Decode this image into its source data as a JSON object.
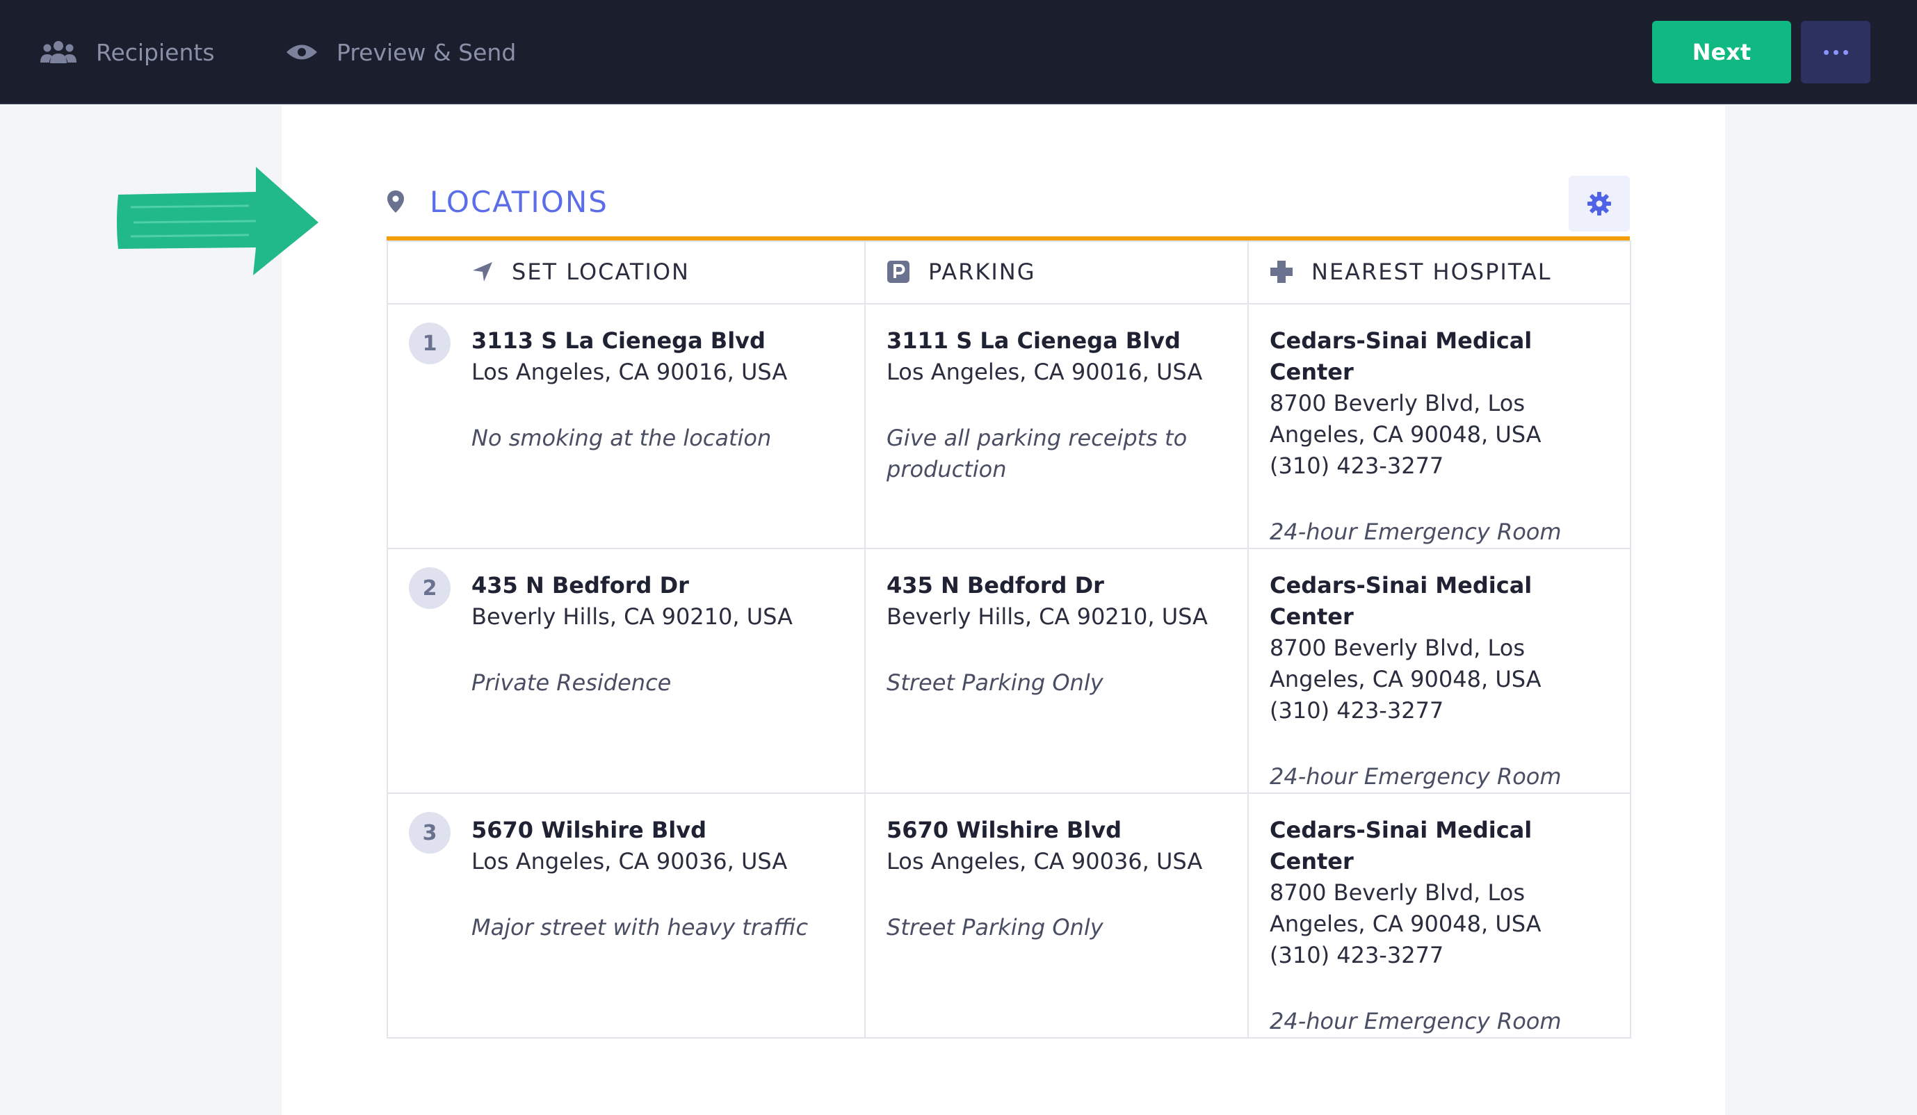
{
  "nav": {
    "recipients": "Recipients",
    "preview_send": "Preview & Send",
    "next": "Next"
  },
  "section": {
    "title": "LOCATIONS"
  },
  "columns": {
    "set_location": "SET LOCATION",
    "parking": "PARKING",
    "nearest_hospital": "NEAREST HOSPITAL"
  },
  "rows": [
    {
      "number": "1",
      "location": {
        "street": "3113 S La Cienega Blvd",
        "city": "Los Angeles, CA 90016, USA",
        "note": "No smoking at the location"
      },
      "parking": {
        "street": "3111 S La Cienega Blvd",
        "city": "Los Angeles, CA 90016, USA",
        "note": "Give all parking receipts to production"
      },
      "hospital": {
        "name": "Cedars-Sinai Medical Center",
        "address": "8700 Beverly Blvd, Los Angeles, CA 90048, USA",
        "phone": "(310) 423-3277",
        "note": "24-hour Emergency Room"
      }
    },
    {
      "number": "2",
      "location": {
        "street": "435 N Bedford Dr",
        "city": "Beverly Hills, CA 90210, USA",
        "note": "Private Residence"
      },
      "parking": {
        "street": "435 N Bedford Dr",
        "city": "Beverly Hills, CA 90210, USA",
        "note": "Street Parking Only"
      },
      "hospital": {
        "name": "Cedars-Sinai Medical Center",
        "address": "8700 Beverly Blvd, Los Angeles, CA 90048, USA",
        "phone": "(310) 423-3277",
        "note": "24-hour Emergency Room"
      }
    },
    {
      "number": "3",
      "location": {
        "street": "5670 Wilshire Blvd",
        "city": "Los Angeles, CA 90036, USA",
        "note": "Major street with heavy traffic"
      },
      "parking": {
        "street": "5670 Wilshire Blvd",
        "city": "Los Angeles, CA 90036, USA",
        "note": "Street Parking Only"
      },
      "hospital": {
        "name": "Cedars-Sinai Medical Center",
        "address": "8700 Beverly Blvd, Los Angeles, CA 90048, USA",
        "phone": "(310) 423-3277",
        "note": "24-hour Emergency Room"
      }
    }
  ],
  "icons": {
    "recipients": "users-icon",
    "preview": "eye-icon",
    "more": "ellipsis-icon",
    "section": "map-pin-icon",
    "settings": "gear-icon",
    "set_location": "navigation-arrow-icon",
    "parking": "parking-icon",
    "hospital": "medical-cross-icon",
    "annotation": "arrow-right-icon"
  },
  "colors": {
    "topbar": "#1b1e2d",
    "next_button": "#10b981",
    "accent": "#5b6ee8",
    "divider": "#f59e0b",
    "annotation_arrow": "#22b98a"
  }
}
